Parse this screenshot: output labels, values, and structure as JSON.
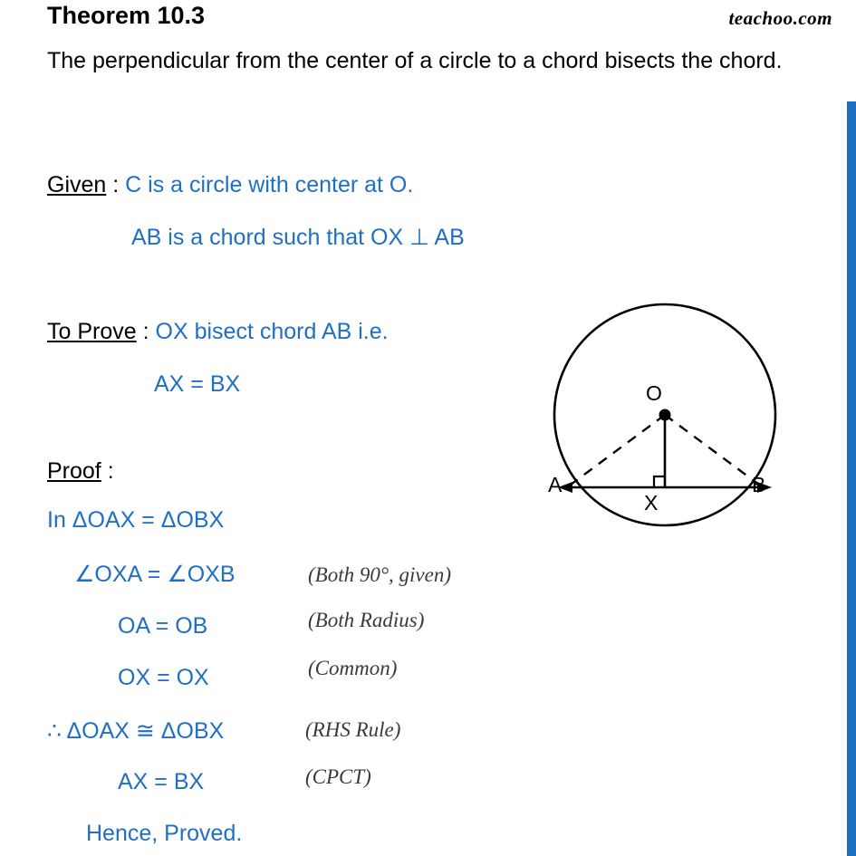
{
  "document": {
    "title": "Theorem 10.3",
    "brand": "teachoo.com",
    "statement": "The perpendicular from the center of a circle to a chord bisects the chord.",
    "given": {
      "label": "Given",
      "separator": " : ",
      "line1": "C is a circle with center at O.",
      "line2": "AB is a chord such that  OX ⊥ AB"
    },
    "to_prove": {
      "label": "To Prove",
      "separator": " : ",
      "line1": "OX bisect chord AB i.e.",
      "line2": "AX = BX"
    },
    "proof": {
      "label": "Proof",
      "separator": " :",
      "intro": "In ΔOAX = ΔOBX",
      "steps": [
        {
          "statement": "∠OXA = ∠OXB",
          "reason": "(Both 90°, given)"
        },
        {
          "statement": "OA = OB",
          "reason": "(Both Radius)"
        },
        {
          "statement": "OX = OX",
          "reason": "(Common)"
        },
        {
          "statement": "∴ ΔOAX ≅ ΔOBX",
          "reason": "(RHS Rule)"
        },
        {
          "statement": "AX = BX",
          "reason": "(CPCT)"
        }
      ],
      "conclusion": "Hence, Proved."
    },
    "figure": {
      "labels": {
        "center": "O",
        "left_point": "A",
        "right_point": "B",
        "foot_point": "X"
      }
    },
    "colors": {
      "accent_blue": "#1f6fc4",
      "text_black": "#000000",
      "reason_gray": "#3a3a3a"
    }
  }
}
